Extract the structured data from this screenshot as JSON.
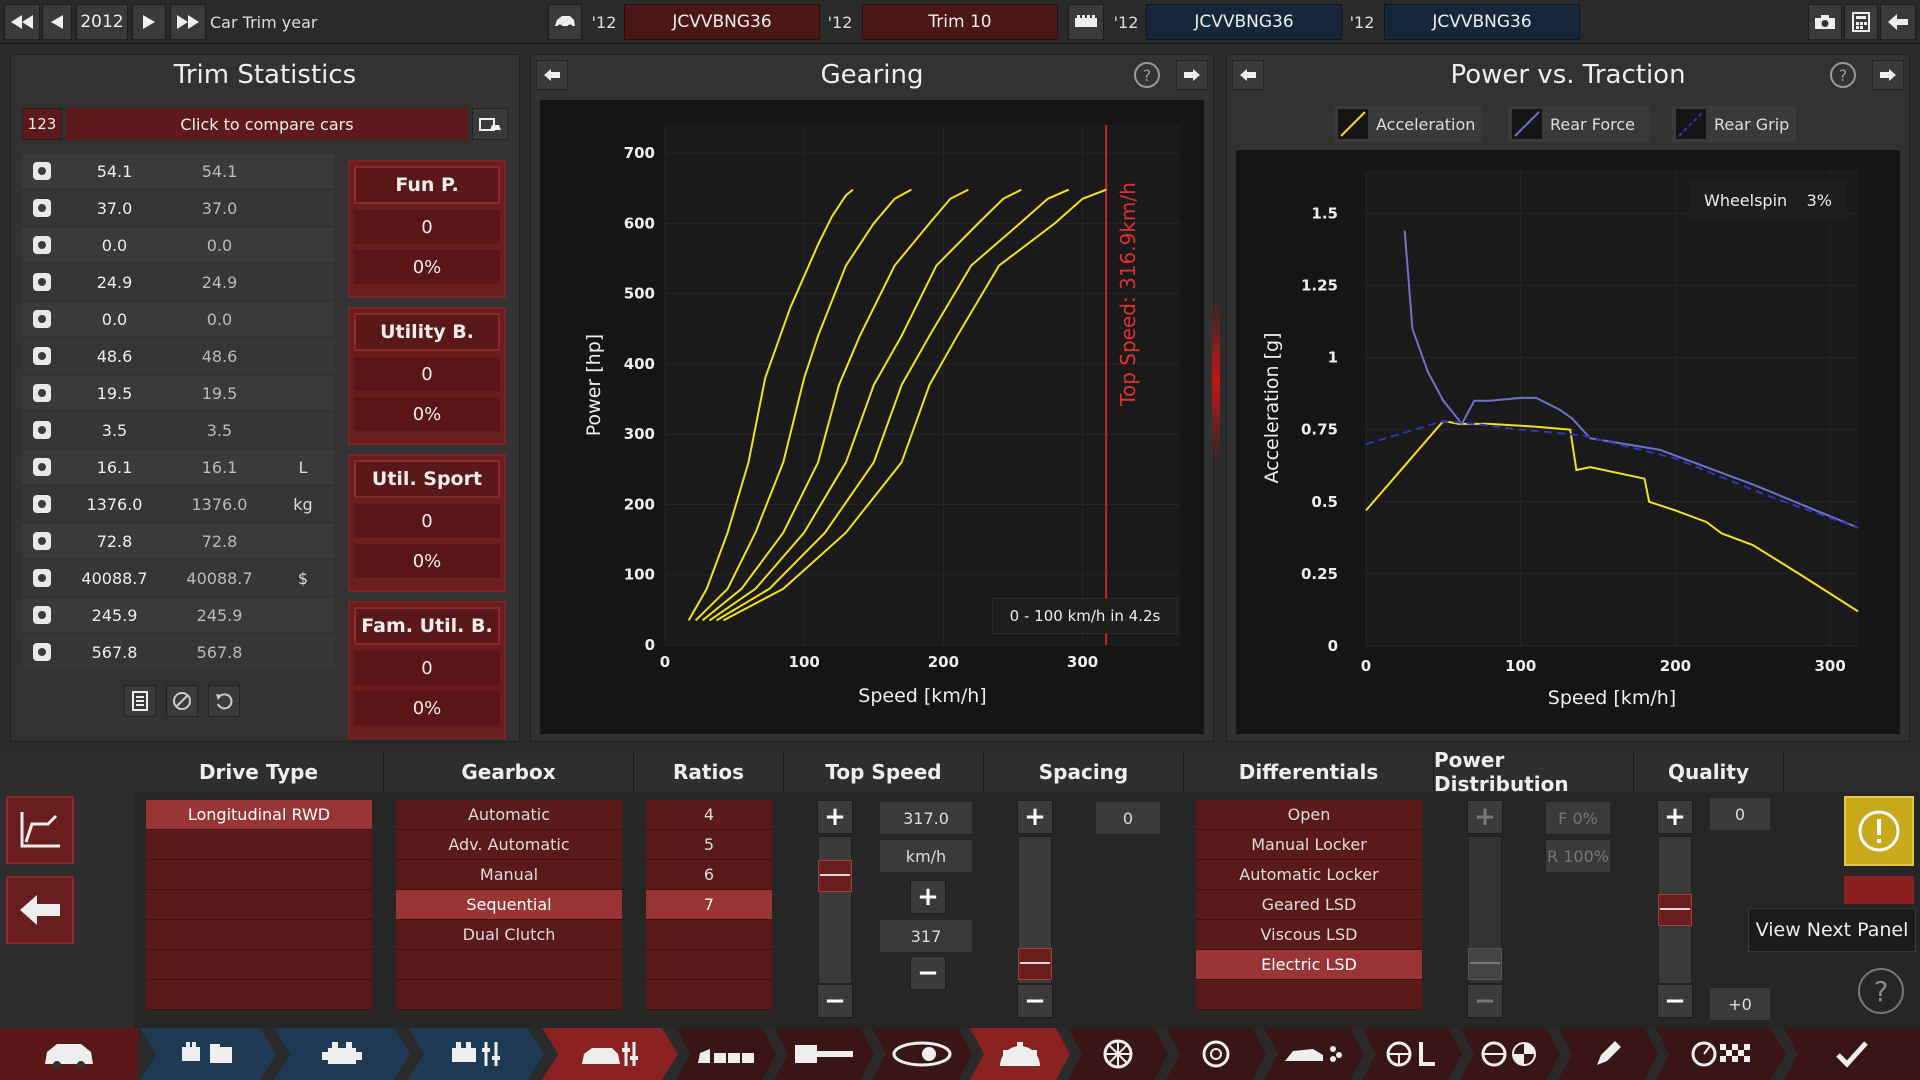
{
  "topbar": {
    "year": "2012",
    "title": "Car Trim year",
    "slots": [
      {
        "year": "'12",
        "name": "JCVVBNG36"
      },
      {
        "year": "'12",
        "name": "Trim 10"
      },
      {
        "year": "'12",
        "name": "JCVVBNG36"
      },
      {
        "year": "'12",
        "name": "JCVVBNG36"
      }
    ]
  },
  "trim_stats": {
    "title": "Trim Statistics",
    "compare_code": "123",
    "compare_label": "Click to compare cars",
    "rows": [
      {
        "icon": "steering-wheel-icon",
        "a": "54.1",
        "b": "54.1",
        "unit": ""
      },
      {
        "icon": "checkered-flag-icon",
        "a": "37.0",
        "b": "37.0",
        "unit": ""
      },
      {
        "icon": "seat-icon",
        "a": "0.0",
        "b": "0.0",
        "unit": ""
      },
      {
        "icon": "diamond-icon",
        "a": "24.9",
        "b": "24.9",
        "unit": ""
      },
      {
        "icon": "safety-icon",
        "a": "0.0",
        "b": "0.0",
        "unit": ""
      },
      {
        "icon": "passengers-icon",
        "a": "48.6",
        "b": "48.6",
        "unit": ""
      },
      {
        "icon": "truck-icon",
        "a": "19.5",
        "b": "19.5",
        "unit": ""
      },
      {
        "icon": "offroad-icon",
        "a": "3.5",
        "b": "3.5",
        "unit": ""
      },
      {
        "icon": "fuel-icon",
        "a": "16.1",
        "b": "16.1",
        "unit": "L"
      },
      {
        "icon": "weight-icon",
        "a": "1376.0",
        "b": "1376.0",
        "unit": "kg"
      },
      {
        "icon": "service-icon",
        "a": "72.8",
        "b": "72.8",
        "unit": ""
      },
      {
        "icon": "cost-icon",
        "a": "40088.7",
        "b": "40088.7",
        "unit": "$"
      },
      {
        "icon": "production-icon",
        "a": "245.9",
        "b": "245.9",
        "unit": ""
      },
      {
        "icon": "engineering-icon",
        "a": "567.8",
        "b": "567.8",
        "unit": ""
      }
    ],
    "scores": [
      {
        "title": "Fun P.",
        "value": "0",
        "pct": "0%"
      },
      {
        "title": "Utility B.",
        "value": "0",
        "pct": "0%"
      },
      {
        "title": "Util. Sport",
        "value": "0",
        "pct": "0%"
      },
      {
        "title": "Fam. Util. B.",
        "value": "0",
        "pct": "0%"
      }
    ]
  },
  "gearing": {
    "title": "Gearing",
    "top_speed_label": "Top Speed: 316.9km/h",
    "accel_label": "0 - 100 km/h in 4.2s"
  },
  "traction": {
    "title": "Power vs. Traction",
    "wheelspin_label": "Wheelspin",
    "wheelspin_value": "3%"
  },
  "chart_data": [
    {
      "type": "line",
      "title": "Gearing",
      "xlabel": "Speed [km/h]",
      "ylabel": "Power [hp]",
      "xlim": [
        0,
        370
      ],
      "ylim": [
        0,
        740
      ],
      "xticks": [
        0,
        100,
        200,
        300
      ],
      "yticks": [
        0,
        100,
        200,
        300,
        400,
        500,
        600,
        700
      ],
      "top_speed": 316.9,
      "series": [
        {
          "name": "",
          "color": "#f2e21a",
          "x": [
            17,
            30,
            45,
            60,
            72,
            90,
            110,
            120,
            130,
            135
          ],
          "y": [
            35,
            80,
            160,
            260,
            380,
            480,
            570,
            610,
            640,
            648
          ]
        },
        {
          "name": "",
          "color": "#f2e21a",
          "x": [
            22,
            45,
            65,
            85,
            100,
            110,
            130,
            150,
            165,
            177
          ],
          "y": [
            35,
            80,
            160,
            260,
            380,
            440,
            540,
            600,
            635,
            648
          ]
        },
        {
          "name": "",
          "color": "#f2e21a",
          "x": [
            27,
            55,
            85,
            110,
            125,
            140,
            165,
            190,
            205,
            218
          ],
          "y": [
            35,
            80,
            160,
            260,
            370,
            440,
            540,
            600,
            635,
            648
          ]
        },
        {
          "name": "",
          "color": "#f2e21a",
          "x": [
            32,
            65,
            100,
            130,
            150,
            170,
            195,
            225,
            243,
            256
          ],
          "y": [
            35,
            80,
            160,
            260,
            370,
            440,
            540,
            600,
            635,
            648
          ]
        },
        {
          "name": "",
          "color": "#f2e21a",
          "x": [
            37,
            75,
            115,
            150,
            170,
            190,
            220,
            255,
            275,
            290
          ],
          "y": [
            35,
            80,
            160,
            260,
            370,
            440,
            540,
            600,
            635,
            648
          ]
        },
        {
          "name": "",
          "color": "#f2e21a",
          "x": [
            42,
            85,
            130,
            170,
            190,
            210,
            240,
            280,
            300,
            317
          ],
          "y": [
            35,
            80,
            160,
            260,
            370,
            440,
            540,
            600,
            635,
            648
          ]
        }
      ]
    },
    {
      "type": "line",
      "title": "Power vs. Traction",
      "xlabel": "Speed [km/h]",
      "ylabel": "Acceleration [g]",
      "xlim": [
        0,
        318
      ],
      "ylim": [
        0,
        1.65
      ],
      "xticks": [
        0,
        100,
        200,
        300
      ],
      "yticks": [
        0,
        0.25,
        0.5,
        0.75,
        1,
        1.25,
        1.5
      ],
      "ytick_labels": [
        "0",
        "0.25",
        "0.5",
        "0.75",
        "1",
        "1.25",
        "1.5"
      ],
      "legend": "top",
      "series": [
        {
          "name": "Acceleration",
          "color": "#f2e21a",
          "x": [
            0,
            50,
            60,
            80,
            110,
            132,
            136,
            145,
            180,
            183,
            200,
            220,
            230,
            250,
            280,
            318
          ],
          "y": [
            0.47,
            0.78,
            0.77,
            0.77,
            0.76,
            0.75,
            0.61,
            0.62,
            0.58,
            0.5,
            0.47,
            0.43,
            0.39,
            0.35,
            0.25,
            0.12
          ]
        },
        {
          "name": "Rear Force",
          "color": "#7070cc",
          "x": [
            25,
            30,
            40,
            50,
            62,
            70,
            80,
            100,
            110,
            125,
            133,
            145,
            190,
            250,
            318
          ],
          "y": [
            1.44,
            1.1,
            0.95,
            0.85,
            0.77,
            0.85,
            0.85,
            0.86,
            0.86,
            0.82,
            0.79,
            0.72,
            0.68,
            0.56,
            0.41
          ]
        },
        {
          "name": "Rear Grip",
          "color": "#3434b8",
          "dashed": true,
          "x": [
            0,
            50,
            70,
            100,
            140,
            200,
            260,
            318
          ],
          "y": [
            0.7,
            0.78,
            0.77,
            0.75,
            0.73,
            0.65,
            0.52,
            0.41
          ]
        }
      ]
    }
  ],
  "bottom": {
    "drive_type": {
      "title": "Drive Type",
      "options": [
        "Longitudinal RWD"
      ],
      "selected": 0
    },
    "gearbox": {
      "title": "Gearbox",
      "options": [
        "Automatic",
        "Adv. Automatic",
        "Manual",
        "Sequential",
        "Dual Clutch"
      ],
      "selected": 3
    },
    "ratios": {
      "title": "Ratios",
      "options": [
        "4",
        "5",
        "6",
        "7"
      ],
      "selected": 3
    },
    "top_speed": {
      "title": "Top Speed",
      "value": "317.0",
      "unit": "km/h",
      "target": "317"
    },
    "spacing": {
      "title": "Spacing",
      "value": "0"
    },
    "differentials": {
      "title": "Differentials",
      "options": [
        "Open",
        "Manual Locker",
        "Automatic Locker",
        "Geared LSD",
        "Viscous LSD",
        "Electric LSD"
      ],
      "selected": 5
    },
    "power_distribution": {
      "title": "Power Distribution",
      "front": "F 0%",
      "rear": "R 100%"
    },
    "quality": {
      "title": "Quality",
      "value": "0",
      "delta": "+0"
    },
    "tooltip": "View Next Panel"
  }
}
